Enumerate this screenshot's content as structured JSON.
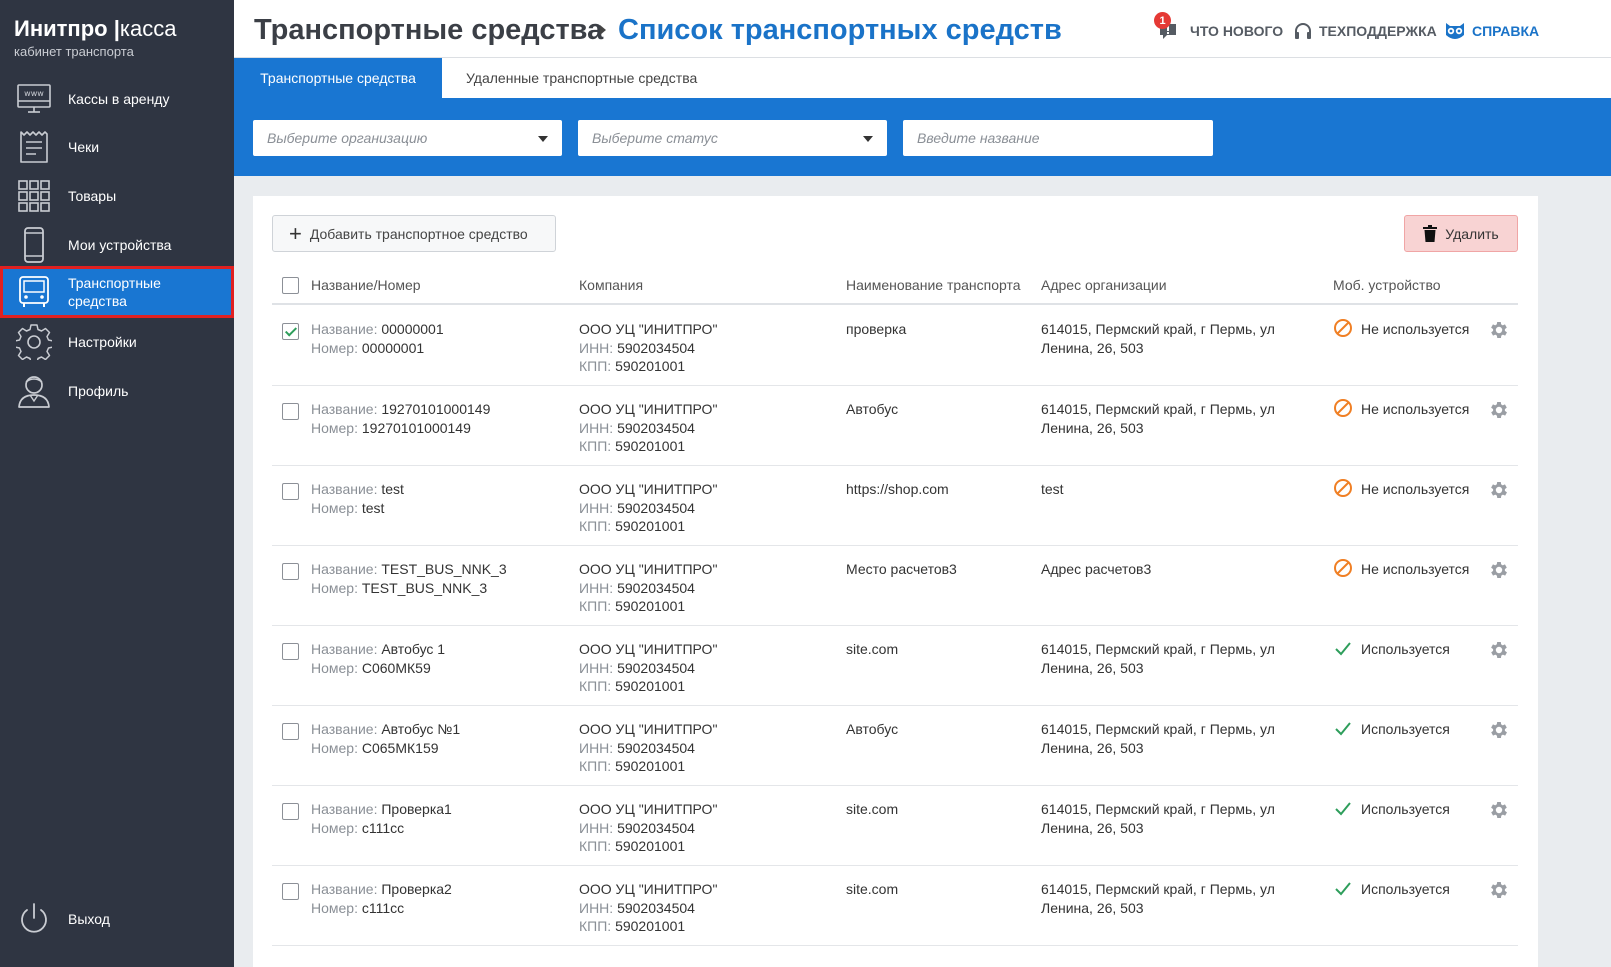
{
  "brand": {
    "name": "Инитпро",
    "separator": "|",
    "product": "касса",
    "subtitle": "кабинет транспорта"
  },
  "sidebar": {
    "items": [
      {
        "label": "Кассы в аренду",
        "icon": "www-monitor-icon"
      },
      {
        "label": "Чеки",
        "icon": "receipt-icon"
      },
      {
        "label": "Товары",
        "icon": "grid-icon"
      },
      {
        "label": "Мои устройства",
        "icon": "smartphone-icon"
      },
      {
        "label": "Транспортные средства",
        "icon": "bus-icon",
        "active": true
      },
      {
        "label": "Настройки",
        "icon": "gear-icon"
      },
      {
        "label": "Профиль",
        "icon": "user-icon"
      }
    ],
    "logout": {
      "label": "Выход",
      "icon": "power-icon"
    }
  },
  "header": {
    "crumb1": "Транспортные средства",
    "crumb2": "Список транспортных средств",
    "whats_new": "ЧТО НОВОГО",
    "whats_new_badge": "1",
    "support": "ТЕХПОДДЕРЖКА",
    "help": "СПРАВКА"
  },
  "tabs": [
    {
      "label": "Транспортные средства",
      "active": true
    },
    {
      "label": "Удаленные транспортные средства",
      "active": false
    }
  ],
  "filters": {
    "org_placeholder": "Выберите организацию",
    "status_placeholder": "Выберите статус",
    "name_placeholder": "Введите название"
  },
  "toolbar": {
    "add_label": "Добавить транспортное средство",
    "delete_label": "Удалить"
  },
  "table": {
    "columns": [
      "Название/Номер",
      "Компания",
      "Наименование транспорта",
      "Адрес организации",
      "Моб. устройство"
    ],
    "labels": {
      "name": "Название: ",
      "number": "Номер: ",
      "inn": "ИНН: ",
      "kpp": "КПП: "
    },
    "rows": [
      {
        "checked": true,
        "name": "00000001",
        "number": "00000001",
        "company": "ООО УЦ \"ИНИТПРО\"",
        "inn": "5902034504",
        "kpp": "590201001",
        "transport": "проверка",
        "address": "614015, Пермский край, г Пермь, ул Ленина, 26, 503",
        "status": "Не используется",
        "used": false
      },
      {
        "checked": false,
        "name": "19270101000149",
        "number": "19270101000149",
        "company": "ООО УЦ \"ИНИТПРО\"",
        "inn": "5902034504",
        "kpp": "590201001",
        "transport": "Автобус",
        "address": "614015, Пермский край, г Пермь, ул Ленина, 26, 503",
        "status": "Не используется",
        "used": false
      },
      {
        "checked": false,
        "name": "test",
        "number": "test",
        "company": "ООО УЦ \"ИНИТПРО\"",
        "inn": "5902034504",
        "kpp": "590201001",
        "transport": "https://shop.com",
        "address": "test",
        "status": "Не используется",
        "used": false
      },
      {
        "checked": false,
        "name": "TEST_BUS_NNK_3",
        "number": "TEST_BUS_NNK_3",
        "company": "ООО УЦ \"ИНИТПРО\"",
        "inn": "5902034504",
        "kpp": "590201001",
        "transport": "Место расчетов3",
        "address": "Адрес расчетов3",
        "status": "Не используется",
        "used": false
      },
      {
        "checked": false,
        "name": "Автобус 1",
        "number": "С060МК59",
        "company": "ООО УЦ \"ИНИТПРО\"",
        "inn": "5902034504",
        "kpp": "590201001",
        "transport": "site.com",
        "address": "614015, Пермский край, г Пермь, ул Ленина, 26, 503",
        "status": "Используется",
        "used": true
      },
      {
        "checked": false,
        "name": "Автобус №1",
        "number": "С065МК159",
        "company": "ООО УЦ \"ИНИТПРО\"",
        "inn": "5902034504",
        "kpp": "590201001",
        "transport": "Автобус",
        "address": "614015, Пермский край, г Пермь, ул Ленина, 26, 503",
        "status": "Используется",
        "used": true
      },
      {
        "checked": false,
        "name": "Проверка1",
        "number": "с111сс",
        "company": "ООО УЦ \"ИНИТПРО\"",
        "inn": "5902034504",
        "kpp": "590201001",
        "transport": "site.com",
        "address": "614015, Пермский край, г Пермь, ул Ленина, 26, 503",
        "status": "Используется",
        "used": true
      },
      {
        "checked": false,
        "name": "Проверка2",
        "number": "с111сс",
        "company": "ООО УЦ \"ИНИТПРО\"",
        "inn": "5902034504",
        "kpp": "590201001",
        "transport": "site.com",
        "address": "614015, Пермский край, г Пермь, ул Ленина, 26, 503",
        "status": "Используется",
        "used": true
      }
    ]
  },
  "colors": {
    "sidebar": "#2f3542",
    "accent": "#1976d2",
    "active_outline": "#e02020",
    "status_unused": "#f07f24",
    "status_used": "#2e9e5b",
    "delete_bg": "#f8d3d3"
  }
}
